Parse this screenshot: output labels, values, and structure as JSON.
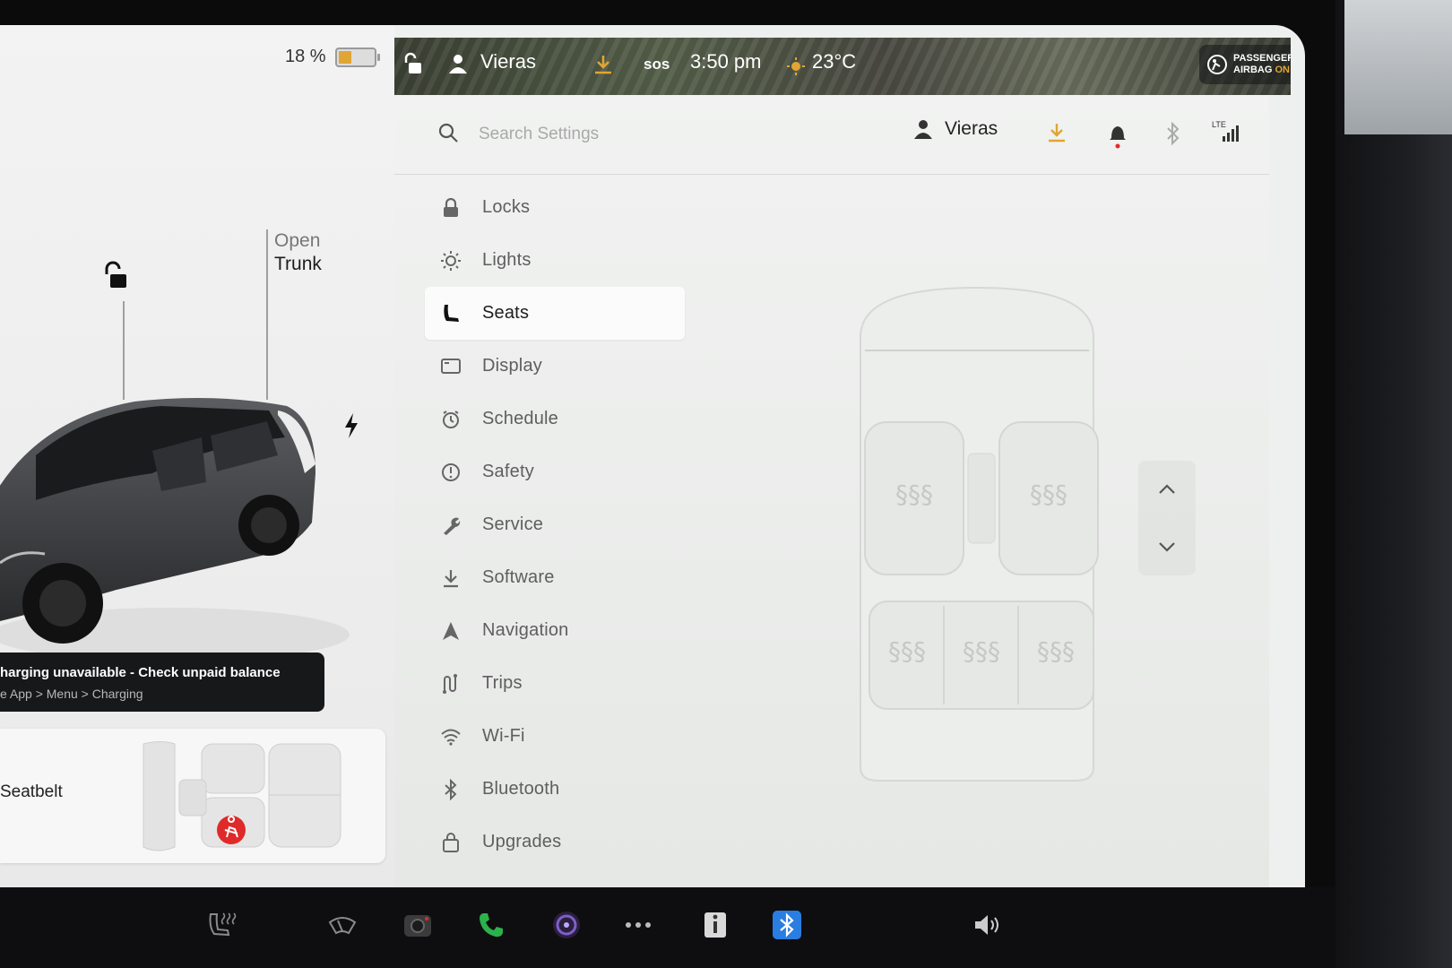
{
  "left_panel": {
    "battery_percent_label": "18 %",
    "battery_fraction": 0.18,
    "open_trunk_line1": "Open",
    "open_trunk_line2": "Trunk",
    "toast_title": "harging unavailable - Check unpaid balance",
    "toast_subtitle": "e App > Menu > Charging",
    "seatbelt_label": "Seatbelt"
  },
  "topbar": {
    "driver_name": "Vieras",
    "sos": "sos",
    "time": "3:50 pm",
    "temperature": "23°C",
    "airbag_line1": "PASSENGER",
    "airbag_line2": "AIRBAG",
    "airbag_state": "ON"
  },
  "settings_header": {
    "search_placeholder": "Search Settings",
    "profile_name": "Vieras",
    "lte_label": "LTE"
  },
  "nav": {
    "items": [
      {
        "label": "Locks",
        "icon": "lock-icon"
      },
      {
        "label": "Lights",
        "icon": "light-icon"
      },
      {
        "label": "Seats",
        "icon": "seat-icon",
        "active": true
      },
      {
        "label": "Display",
        "icon": "display-icon"
      },
      {
        "label": "Schedule",
        "icon": "schedule-icon"
      },
      {
        "label": "Safety",
        "icon": "safety-icon"
      },
      {
        "label": "Service",
        "icon": "wrench-icon"
      },
      {
        "label": "Software",
        "icon": "download-icon"
      },
      {
        "label": "Navigation",
        "icon": "navigation-icon"
      },
      {
        "label": "Trips",
        "icon": "trips-icon"
      },
      {
        "label": "Wi-Fi",
        "icon": "wifi-icon"
      },
      {
        "label": "Bluetooth",
        "icon": "bluetooth-icon"
      },
      {
        "label": "Upgrades",
        "icon": "bag-icon"
      }
    ]
  },
  "colors": {
    "accent_orange": "#e0a534",
    "alert_red": "#e02a2a",
    "bluetooth_blue": "#2a7de1",
    "phone_green": "#2bb24c"
  }
}
